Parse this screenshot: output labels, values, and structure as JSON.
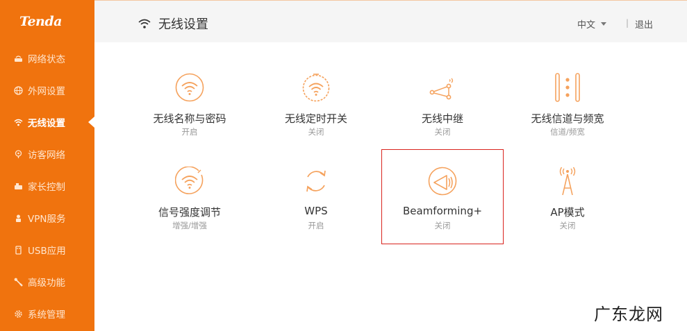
{
  "brand": {
    "logo_text": "Tenda",
    "accent": "#f0730e"
  },
  "sidebar": {
    "items": [
      {
        "label": "网络状态",
        "icon": "router-icon"
      },
      {
        "label": "外网设置",
        "icon": "globe-icon"
      },
      {
        "label": "无线设置",
        "icon": "wifi-icon",
        "active": true
      },
      {
        "label": "访客网络",
        "icon": "guest-icon"
      },
      {
        "label": "家长控制",
        "icon": "parental-icon"
      },
      {
        "label": "VPN服务",
        "icon": "vpn-icon"
      },
      {
        "label": "USB应用",
        "icon": "usb-icon"
      },
      {
        "label": "高级功能",
        "icon": "tools-icon"
      },
      {
        "label": "系统管理",
        "icon": "gear-icon"
      }
    ]
  },
  "header": {
    "title": "无线设置",
    "lang": "中文",
    "separator": "|",
    "logout": "退出"
  },
  "tiles": [
    {
      "name": "无线名称与密码",
      "status": "开启",
      "icon": "wifi-circle-icon"
    },
    {
      "name": "无线定时开关",
      "status": "关闭",
      "icon": "wifi-timer-icon"
    },
    {
      "name": "无线中继",
      "status": "关闭",
      "icon": "repeater-icon"
    },
    {
      "name": "无线信道与频宽",
      "status": "信道/频宽",
      "icon": "channel-icon"
    },
    {
      "name": "信号强度调节",
      "status": "增强/增强",
      "icon": "signal-strength-icon"
    },
    {
      "name": "WPS",
      "status": "开启",
      "icon": "wps-icon"
    },
    {
      "name": "Beamforming+",
      "status": "关闭",
      "icon": "beamforming-icon",
      "highlighted": true
    },
    {
      "name": "AP模式",
      "status": "关闭",
      "icon": "ap-antenna-icon"
    }
  ],
  "watermark": "广东龙网"
}
